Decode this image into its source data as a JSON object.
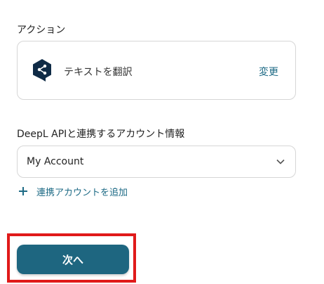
{
  "action_section": {
    "label": "アクション",
    "action_name": "テキストを翻訳",
    "change_label": "変更",
    "logo_icon": "deepl-logo-icon"
  },
  "account_section": {
    "label": "DeepL APIと連携するアカウント情報",
    "selected_account": "My Account",
    "add_account_label": "連携アカウントを追加"
  },
  "footer": {
    "next_label": "次へ"
  },
  "colors": {
    "accent": "#1e6680",
    "link": "#1d6a85",
    "logo": "#0f2b46",
    "highlight": "#e01a1a"
  }
}
